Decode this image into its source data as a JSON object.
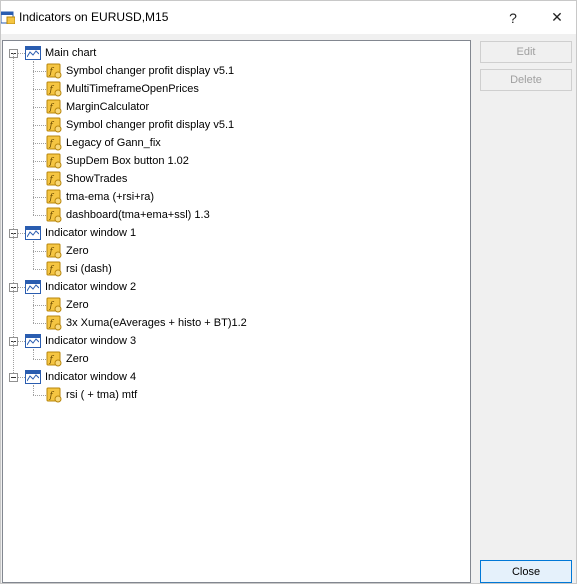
{
  "window": {
    "title": "Indicators on EURUSD,M15",
    "help_label": "?",
    "close_label": "✕"
  },
  "tree": {
    "groups": [
      {
        "label": "Main chart",
        "items": [
          "Symbol changer profit display v5.1",
          "MultiTimeframeOpenPrices",
          "MarginCalculator",
          "Symbol changer profit display v5.1",
          "Legacy of Gann_fix",
          "SupDem Box button 1.02",
          "ShowTrades",
          "tma-ema (+rsi+ra)",
          "dashboard(tma+ema+ssl) 1.3"
        ]
      },
      {
        "label": "Indicator window 1",
        "items": [
          "Zero",
          "rsi (dash)"
        ]
      },
      {
        "label": "Indicator window 2",
        "items": [
          "Zero",
          "3x Xuma(eAverages + histo + BT)1.2"
        ]
      },
      {
        "label": "Indicator window 3",
        "items": [
          "Zero"
        ]
      },
      {
        "label": "Indicator window 4",
        "items": [
          "rsi ( + tma) mtf"
        ]
      }
    ]
  },
  "buttons": {
    "edit": "Edit",
    "delete": "Delete",
    "close": "Close"
  },
  "colors": {
    "window_icon": "#2a5db0",
    "indicator_icon": "#f5c542",
    "disabled_text": "#a0a0a0",
    "default_button_border": "#0078d7"
  }
}
